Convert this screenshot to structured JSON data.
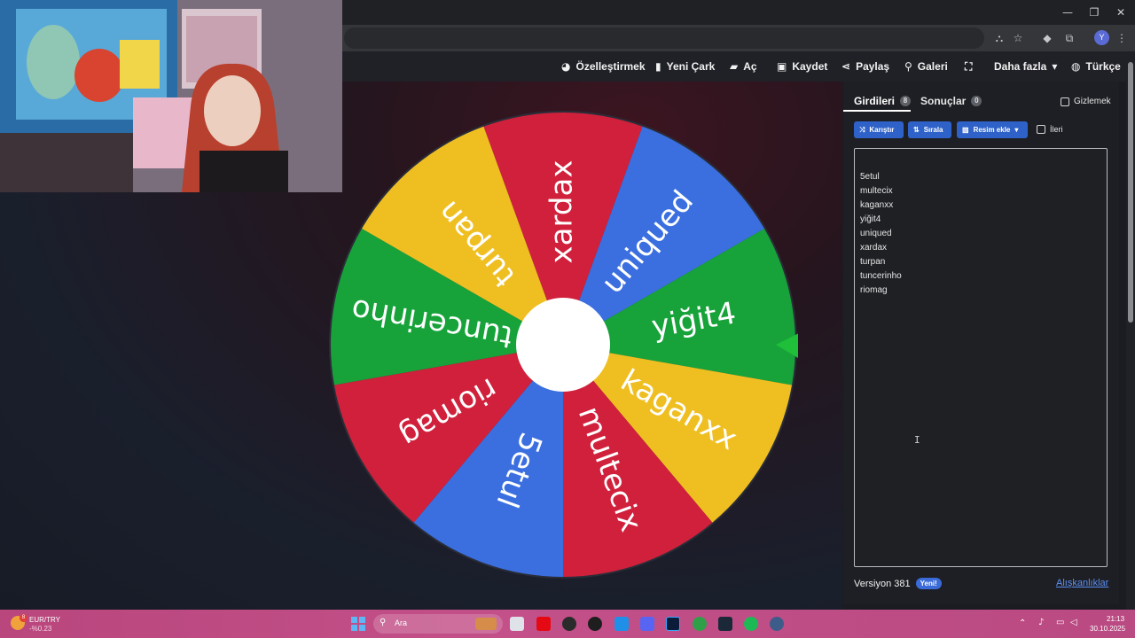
{
  "browser": {
    "window_controls": {
      "minimize": "—",
      "maximize": "❐",
      "close": "✕"
    },
    "icons": [
      "translate-icon",
      "bookmark-star-icon",
      "extension-icon",
      "puzzle-icon",
      "menu-kebab-icon"
    ],
    "profile_initial": "Y"
  },
  "toolbar": {
    "items": [
      {
        "label": "Özelleştirmek",
        "icon": "palette-icon"
      },
      {
        "label": "Yeni Çark",
        "icon": "file-icon"
      },
      {
        "label": "Aç",
        "icon": "folder-open-icon"
      },
      {
        "label": "Kaydet",
        "icon": "save-icon"
      },
      {
        "label": "Paylaş",
        "icon": "share-icon"
      },
      {
        "label": "Galeri",
        "icon": "search-icon"
      },
      {
        "label": "",
        "icon": "fullscreen-icon"
      },
      {
        "label": "Daha fazla",
        "icon": "caret-down-icon"
      },
      {
        "label": "Türkçe",
        "icon": "globe-icon"
      }
    ]
  },
  "wheel": {
    "segments": [
      {
        "label": "xardax",
        "color": "#d0203c"
      },
      {
        "label": "uniqued",
        "color": "#3b6fe0"
      },
      {
        "label": "yiğit4",
        "color": "#17a33a"
      },
      {
        "label": "kaganxx",
        "color": "#efbf22"
      },
      {
        "label": "multecix",
        "color": "#d0203c"
      },
      {
        "label": "5etul",
        "color": "#3b6fe0"
      },
      {
        "label": "riomag",
        "color": "#d0203c"
      },
      {
        "label": "tuncerinho",
        "color": "#17a33a"
      },
      {
        "label": "turpan",
        "color": "#efbf22"
      }
    ],
    "pointer_color": "#1fbf3a"
  },
  "panel": {
    "tabs": [
      {
        "label": "Girdileri",
        "count": "8"
      },
      {
        "label": "Sonuçlar",
        "count": "0"
      }
    ],
    "hide_label": "Gizlemek",
    "buttons": {
      "shuffle": "Karıştır",
      "sort": "Sırala",
      "add_image": "Resim ekle"
    },
    "advanced_label": "İleri",
    "entries": [
      "5etul",
      "multecix",
      "kaganxx",
      "yiğit4",
      "uniqued",
      "xardax",
      "turpan",
      "tuncerinho",
      "riomag"
    ],
    "version": "Versiyon 381",
    "new_badge": "Yeni!",
    "preferences": "Alışkanlıklar"
  },
  "taskbar": {
    "ticker_name": "EUR/TRY",
    "ticker_change": "-%0.23",
    "weather_badge": "8",
    "search_placeholder": "Ara",
    "time": "21:13",
    "date": "30.10.2025"
  }
}
